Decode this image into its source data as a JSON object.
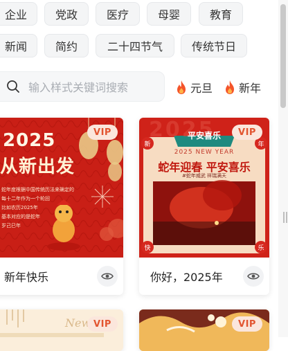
{
  "categories": {
    "row1": [
      "企业",
      "党政",
      "医疗",
      "母婴",
      "教育"
    ],
    "row2": [
      "新闻",
      "简约",
      "二十四节气",
      "传统节日"
    ]
  },
  "search": {
    "placeholder": "输入样式关键词搜索",
    "icon": "search-icon"
  },
  "hot_tags": [
    "元旦",
    "新年"
  ],
  "badge": "VIP",
  "cards": [
    {
      "title": "新年快乐",
      "poster": {
        "year": "2025",
        "headline": "从新出发",
        "body": [
          "蛇年度根据中国传统历法来确定的",
          "每十二年作为一个轮回",
          "比如农历2025年",
          "基本对应的是蛇年",
          "岁己巳年"
        ]
      }
    },
    {
      "title": "你好，2025年",
      "poster": {
        "ribbon": "平安喜乐",
        "bg_year": "2025",
        "subtitle": "2025 NEW YEAR",
        "headline": "蛇年迎春 平安喜乐",
        "tagline": "#蛇年威武  祥瑞满天",
        "corners": [
          "新",
          "年",
          "快",
          "乐"
        ]
      }
    },
    {
      "poster": {
        "deco": "New"
      }
    },
    {
      "poster": {}
    }
  ],
  "colors": {
    "red": "#d6281f",
    "accent": "#e25531",
    "vip_bg": "#fbe6dc",
    "flame": "#f4542a"
  }
}
